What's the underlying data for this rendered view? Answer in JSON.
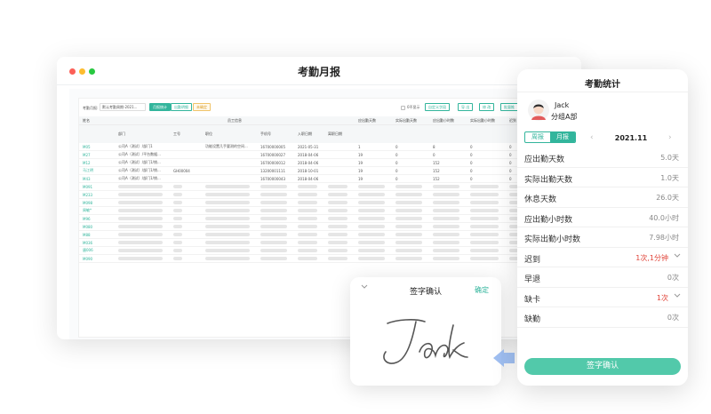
{
  "window": {
    "title": "考勤月报",
    "toolbar": {
      "period_label": "考勤月报:",
      "period_value": "默认考勤周期-2021...",
      "btn_monthly": "月报统计",
      "btn_export": "出勤明细",
      "tag": "未确定",
      "hide_zero": "0不显示",
      "btn_custom": "自定义字段",
      "btn_a": "导 出",
      "btn_b": "修 改",
      "btn_c": "批量推"
    },
    "table": {
      "group_header": "员工信息",
      "headers": [
        "姓名",
        "部门",
        "工号",
        "职位",
        "手机号",
        "入职日期",
        "离职日期",
        "应出勤天数",
        "实际出勤天数",
        "应出勤小时数",
        "实际出勤小时数",
        "迟到"
      ],
      "rows": [
        [
          "M05",
          "公司A（测试）/部门1",
          "",
          "功能设置几手要测的空间...",
          "16700000005",
          "2021-05-31",
          "",
          "1",
          "0",
          "8",
          "0",
          "0"
        ],
        [
          "M27",
          "公司A（测试）/平台数据...",
          "",
          "",
          "16700000027",
          "2018-04-06",
          "",
          "19",
          "0",
          "0",
          "0",
          "0"
        ],
        [
          "M12",
          "公司A（测试）/部门1/销...",
          "",
          "",
          "16700000012",
          "2018-04-06",
          "",
          "19",
          "0",
          "152",
          "0",
          "0"
        ],
        [
          "马江明",
          "公司A（测试）/部门1/销...",
          "GH00004",
          "",
          "13200001111",
          "2018-10-01",
          "",
          "19",
          "0",
          "152",
          "0",
          "0"
        ],
        [
          "M43",
          "公司A（测试）/部门1/销...",
          "",
          "",
          "16700000043",
          "2018-04-06",
          "",
          "19",
          "0",
          "152",
          "0",
          "0"
        ]
      ],
      "skeleton_names": [
        "M091",
        "M233",
        "M098",
        "周敏*",
        "M96",
        "M080",
        "M88",
        "M036",
        "唐006",
        "M090"
      ]
    }
  },
  "signature": {
    "title": "签字确认",
    "confirm": "确定",
    "text": "Jack"
  },
  "phone": {
    "title": "考勤统计",
    "user_name": "Jack",
    "user_group": "分组A部",
    "tab_week": "周报",
    "tab_month": "月报",
    "month": "2021.11",
    "stats": [
      {
        "label": "应出勤天数",
        "value": "5.0天"
      },
      {
        "label": "实际出勤天数",
        "value": "1.0天"
      },
      {
        "label": "休息天数",
        "value": "26.0天"
      },
      {
        "label": "应出勤小时数",
        "value": "40.0小时"
      },
      {
        "label": "实际出勤小时数",
        "value": "7.98小时"
      },
      {
        "label": "迟到",
        "value": "1次,1分钟",
        "highlight": true
      },
      {
        "label": "早退",
        "value": "0次"
      },
      {
        "label": "缺卡",
        "value": "1次",
        "highlight": true
      },
      {
        "label": "缺勤",
        "value": "0次"
      }
    ],
    "confirm_button": "签字确认"
  },
  "colors": {
    "accent": "#32b59c",
    "alert": "#e1453a",
    "button": "#52c9aa"
  }
}
